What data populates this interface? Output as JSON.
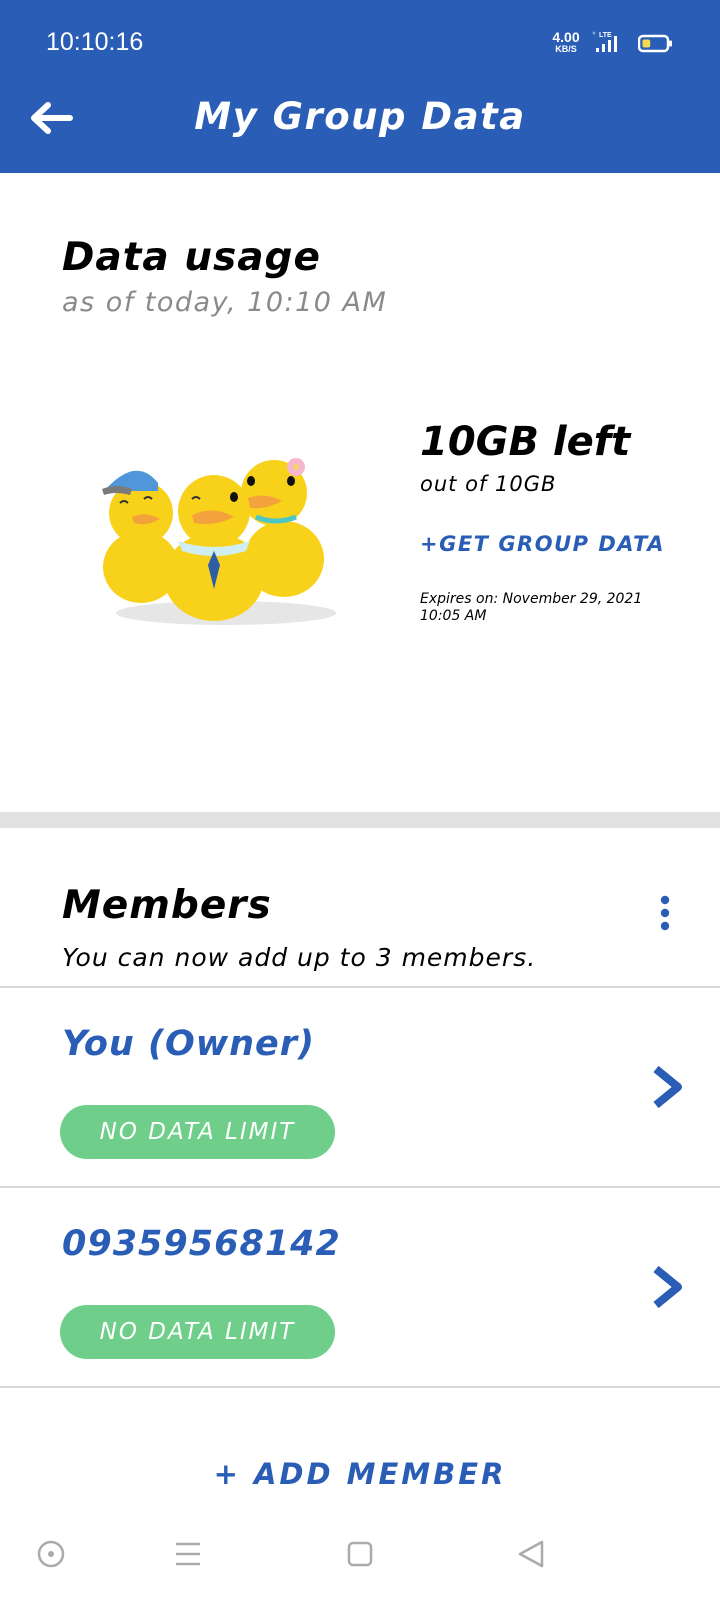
{
  "status_bar": {
    "time": "10:10:16",
    "net_speed_value": "4.00",
    "net_speed_unit": "KB/S",
    "network_type": "LTE",
    "battery_level": 0.35
  },
  "header": {
    "title": "My Group Data",
    "back_icon": "arrow-left-icon"
  },
  "usage": {
    "title": "Data usage",
    "subtitle": "as of today, 10:10 AM",
    "left": "10GB left",
    "out_of": "out of 10GB",
    "get_more_label": "+GET GROUP DATA",
    "expires": "Expires on: November 29, 2021 10:05 AM"
  },
  "members": {
    "title": "Members",
    "subtitle": "You can now add up to 3 members.",
    "menu_icon": "more-vertical-icon",
    "items": [
      {
        "name": "You (Owner)",
        "limit": "NO DATA LIMIT"
      },
      {
        "name": "09359568142",
        "limit": "NO DATA LIMIT"
      }
    ],
    "add_label": "+ ADD MEMBER"
  },
  "nav_bar": {
    "buttons": [
      "assistant-icon",
      "menu-icon",
      "home-icon",
      "back-icon"
    ]
  },
  "colors": {
    "primary": "#2a5db5",
    "badge": "#6fcf8a",
    "divider": "#e2e2e2"
  }
}
